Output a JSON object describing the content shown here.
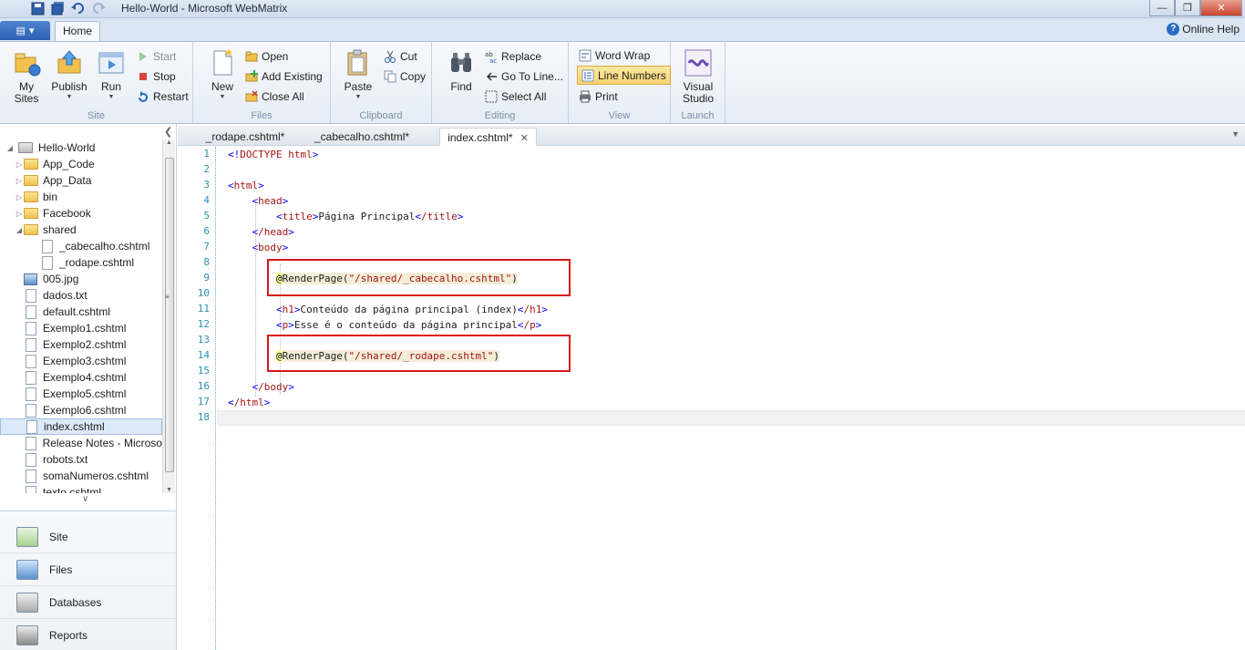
{
  "window": {
    "title": "Hello-World - Microsoft WebMatrix"
  },
  "ribbon": {
    "tab_home": "Home",
    "online_help": "Online Help",
    "groups": {
      "site": {
        "label": "Site",
        "my_sites": "My Sites",
        "publish": "Publish",
        "run": "Run",
        "start": "Start",
        "stop": "Stop",
        "restart": "Restart"
      },
      "files": {
        "label": "Files",
        "new": "New",
        "open": "Open",
        "add_existing": "Add Existing",
        "close_all": "Close All"
      },
      "clipboard": {
        "label": "Clipboard",
        "paste": "Paste",
        "cut": "Cut",
        "copy": "Copy"
      },
      "editing": {
        "label": "Editing",
        "find": "Find",
        "replace": "Replace",
        "go_to_line": "Go To Line...",
        "select_all": "Select All"
      },
      "view": {
        "label": "View",
        "word_wrap": "Word Wrap",
        "line_numbers": "Line Numbers",
        "print": "Print"
      },
      "launch": {
        "label": "Launch",
        "visual_studio": "Visual Studio"
      }
    }
  },
  "tree": {
    "root": "Hello-World",
    "items": [
      {
        "label": "App_Code",
        "kind": "folder"
      },
      {
        "label": "App_Data",
        "kind": "folder"
      },
      {
        "label": "bin",
        "kind": "folder"
      },
      {
        "label": "Facebook",
        "kind": "folder"
      },
      {
        "label": "shared",
        "kind": "folder-open"
      },
      {
        "label": "_cabecalho.cshtml",
        "kind": "file"
      },
      {
        "label": "_rodape.cshtml",
        "kind": "file"
      },
      {
        "label": "005.jpg",
        "kind": "image"
      },
      {
        "label": "dados.txt",
        "kind": "file"
      },
      {
        "label": "default.cshtml",
        "kind": "file"
      },
      {
        "label": "Exemplo1.cshtml",
        "kind": "file"
      },
      {
        "label": "Exemplo2.cshtml",
        "kind": "file"
      },
      {
        "label": "Exemplo3.cshtml",
        "kind": "file"
      },
      {
        "label": "Exemplo4.cshtml",
        "kind": "file"
      },
      {
        "label": "Exemplo5.cshtml",
        "kind": "file"
      },
      {
        "label": "Exemplo6.cshtml",
        "kind": "file"
      },
      {
        "label": "index.cshtml",
        "kind": "file",
        "selected": true
      },
      {
        "label": "Release Notes - Microso",
        "kind": "file"
      },
      {
        "label": "robots.txt",
        "kind": "file"
      },
      {
        "label": "somaNumeros.cshtml",
        "kind": "file"
      },
      {
        "label": "texto.cshtml",
        "kind": "file"
      }
    ]
  },
  "nav": {
    "site": "Site",
    "files": "Files",
    "databases": "Databases",
    "reports": "Reports"
  },
  "editor_tabs": [
    "_rodape.cshtml*",
    "_cabecalho.cshtml*",
    "index.cshtml*"
  ],
  "editor": {
    "line_numbers": [
      "1",
      "2",
      "3",
      "4",
      "5",
      "6",
      "7",
      "8",
      "9",
      "10",
      "11",
      "12",
      "13",
      "14",
      "15",
      "16",
      "17",
      "18"
    ],
    "lines": {
      "l1_doctype": "DOCTYPE",
      "l1_html": "html",
      "l3_tag": "html",
      "l4_tag": "head",
      "l5_tag": "title",
      "l5_text": "Página Principal",
      "l5_close": "/title",
      "l6_tag": "/head",
      "l7_tag": "body",
      "l9_at": "@",
      "l9_method": "RenderPage(",
      "l9_str": "\"/shared/_cabecalho.cshtml\"",
      "l9_close": ")",
      "l11_tag": "h1",
      "l11_text": "Conteúdo da página principal (index)",
      "l11_close": "/h1",
      "l12_tag": "p",
      "l12_text": "Esse é o conteúdo da página principal",
      "l12_close": "/p",
      "l14_at": "@",
      "l14_method": "RenderPage(",
      "l14_str": "\"/shared/_rodape.cshtml\"",
      "l14_close": ")",
      "l16_tag": "/body",
      "l17_tag": "/html"
    }
  },
  "colors": {
    "highlight_box": "#d9161c",
    "line_number": "#2b91af",
    "tag": "#a31515",
    "bracket": "#0000ff"
  }
}
